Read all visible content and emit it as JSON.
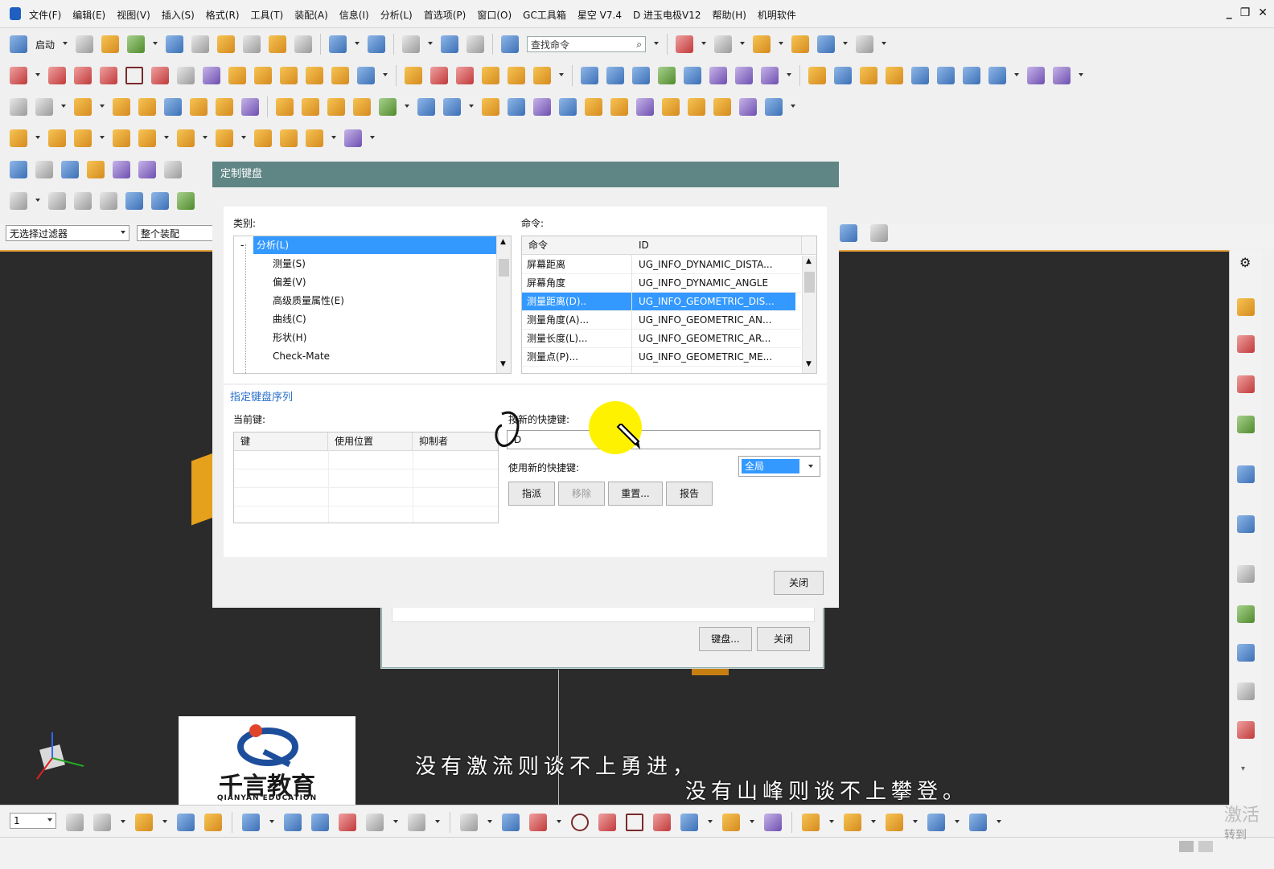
{
  "menubar": {
    "items": [
      "文件(F)",
      "编辑(E)",
      "视图(V)",
      "插入(S)",
      "格式(R)",
      "工具(T)",
      "装配(A)",
      "信息(I)",
      "分析(L)",
      "首选项(P)",
      "窗口(O)",
      "GC工具箱",
      "星空 V7.4",
      "D 进玉电极V12",
      "帮助(H)",
      "机明软件"
    ],
    "window_controls": [
      "_",
      "❐",
      "✕"
    ]
  },
  "toolbar": {
    "start_label": "启动",
    "find_placeholder": "查找命令"
  },
  "filters": {
    "selection_filter": "无选择过滤器",
    "scope": "整个装配"
  },
  "dialog": {
    "title": "定制键盘",
    "category_label": "类别:",
    "command_label": "命令:",
    "tree": [
      {
        "label": "分析(L)",
        "selected": true,
        "expander": "-"
      },
      {
        "label": "测量(S)"
      },
      {
        "label": "偏差(V)"
      },
      {
        "label": "高级质量属性(E)"
      },
      {
        "label": "曲线(C)"
      },
      {
        "label": "形状(H)"
      },
      {
        "label": "Check-Mate"
      }
    ],
    "command_table": {
      "headers": [
        "命令",
        "ID"
      ],
      "rows": [
        {
          "cmd": "屏幕距离",
          "id": "UG_INFO_DYNAMIC_DISTA..."
        },
        {
          "cmd": "屏幕角度",
          "id": "UG_INFO_DYNAMIC_ANGLE"
        },
        {
          "cmd": "测量距离(D)..",
          "id": "UG_INFO_GEOMETRIC_DIS...",
          "selected": true
        },
        {
          "cmd": "测量角度(A)...",
          "id": "UG_INFO_GEOMETRIC_AN..."
        },
        {
          "cmd": "测量长度(L)...",
          "id": "UG_INFO_GEOMETRIC_AR..."
        },
        {
          "cmd": "测量点(P)...",
          "id": "UG_INFO_GEOMETRIC_ME..."
        }
      ]
    },
    "key_section_title": "指定键盘序列",
    "current_keys_label": "当前键:",
    "key_table_headers": [
      "键",
      "使用位置",
      "抑制者"
    ],
    "new_shortcut_label": "按新的快捷键:",
    "new_shortcut_value": "D",
    "use_new_label": "使用新的快捷键:",
    "use_new_value": "全局",
    "buttons": {
      "assign": "指派",
      "remove": "移除",
      "reset": "重置...",
      "report": "报告",
      "close": "关闭"
    }
  },
  "bg_dialog": {
    "keyboard_button": "键盘...",
    "close_button": "关闭"
  },
  "watermark": {
    "brand": "千言教育",
    "brand_en": "QIANYAN EDUCATION"
  },
  "subtitle": {
    "line1": "没有激流则谈不上勇进，",
    "line2": "没有山峰则谈不上攀登。"
  },
  "bottom": {
    "layer_value": "1"
  },
  "activation": {
    "line1": "激活",
    "line2": "转到"
  }
}
